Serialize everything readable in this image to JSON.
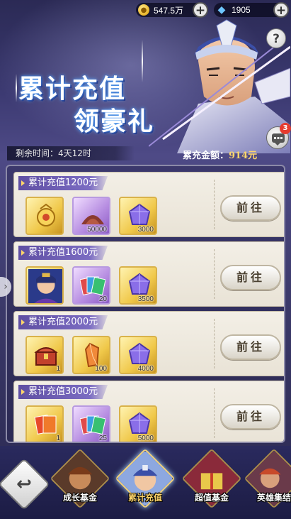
{
  "resources": {
    "gold": {
      "value": "547.5万",
      "icon": "gold-coin-icon"
    },
    "gems": {
      "value": "1905",
      "icon": "diamond-icon"
    }
  },
  "help": {
    "label": "?"
  },
  "event": {
    "title_line1": "累计充值",
    "title_line2": "领豪礼",
    "time_remaining": "剩余时间：4天12时",
    "total_label": "累充金额：",
    "total_value": "914元"
  },
  "chat": {
    "badge_count": "3"
  },
  "tiers": [
    {
      "label": "累计充值1200元",
      "button": "前往",
      "rewards": [
        {
          "icon": "gold-ornament-icon",
          "count": ""
        },
        {
          "icon": "ore-pile-icon",
          "count": "50000"
        },
        {
          "icon": "purple-crystal-icon",
          "count": "3000"
        }
      ]
    },
    {
      "label": "累计充值1600元",
      "button": "前往",
      "rewards": [
        {
          "icon": "hero-portrait-icon",
          "count": ""
        },
        {
          "icon": "hero-cards-icon",
          "count": "20"
        },
        {
          "icon": "purple-crystal-icon",
          "count": "3500"
        }
      ]
    },
    {
      "label": "累计充值2000元",
      "button": "前往",
      "rewards": [
        {
          "icon": "treasure-chest-icon",
          "count": "1"
        },
        {
          "icon": "orange-crystal-icon",
          "count": "100"
        },
        {
          "icon": "purple-crystal-icon",
          "count": "4000"
        }
      ]
    },
    {
      "label": "累计充值3000元",
      "button": "前往",
      "rewards": [
        {
          "icon": "fire-cards-icon",
          "count": "1"
        },
        {
          "icon": "hero-cards-icon",
          "count": "25"
        },
        {
          "icon": "purple-crystal-icon",
          "count": "5000"
        }
      ]
    }
  ],
  "bottom_tabs": [
    {
      "label": "成长基金",
      "active": false
    },
    {
      "label": "累计充值",
      "active": true
    },
    {
      "label": "超值基金",
      "active": false
    },
    {
      "label": "英雄集结",
      "active": false
    }
  ],
  "colors": {
    "accent": "#ffd66b",
    "tier_label": "#6b5bb5",
    "badge": "#e63b2e"
  }
}
